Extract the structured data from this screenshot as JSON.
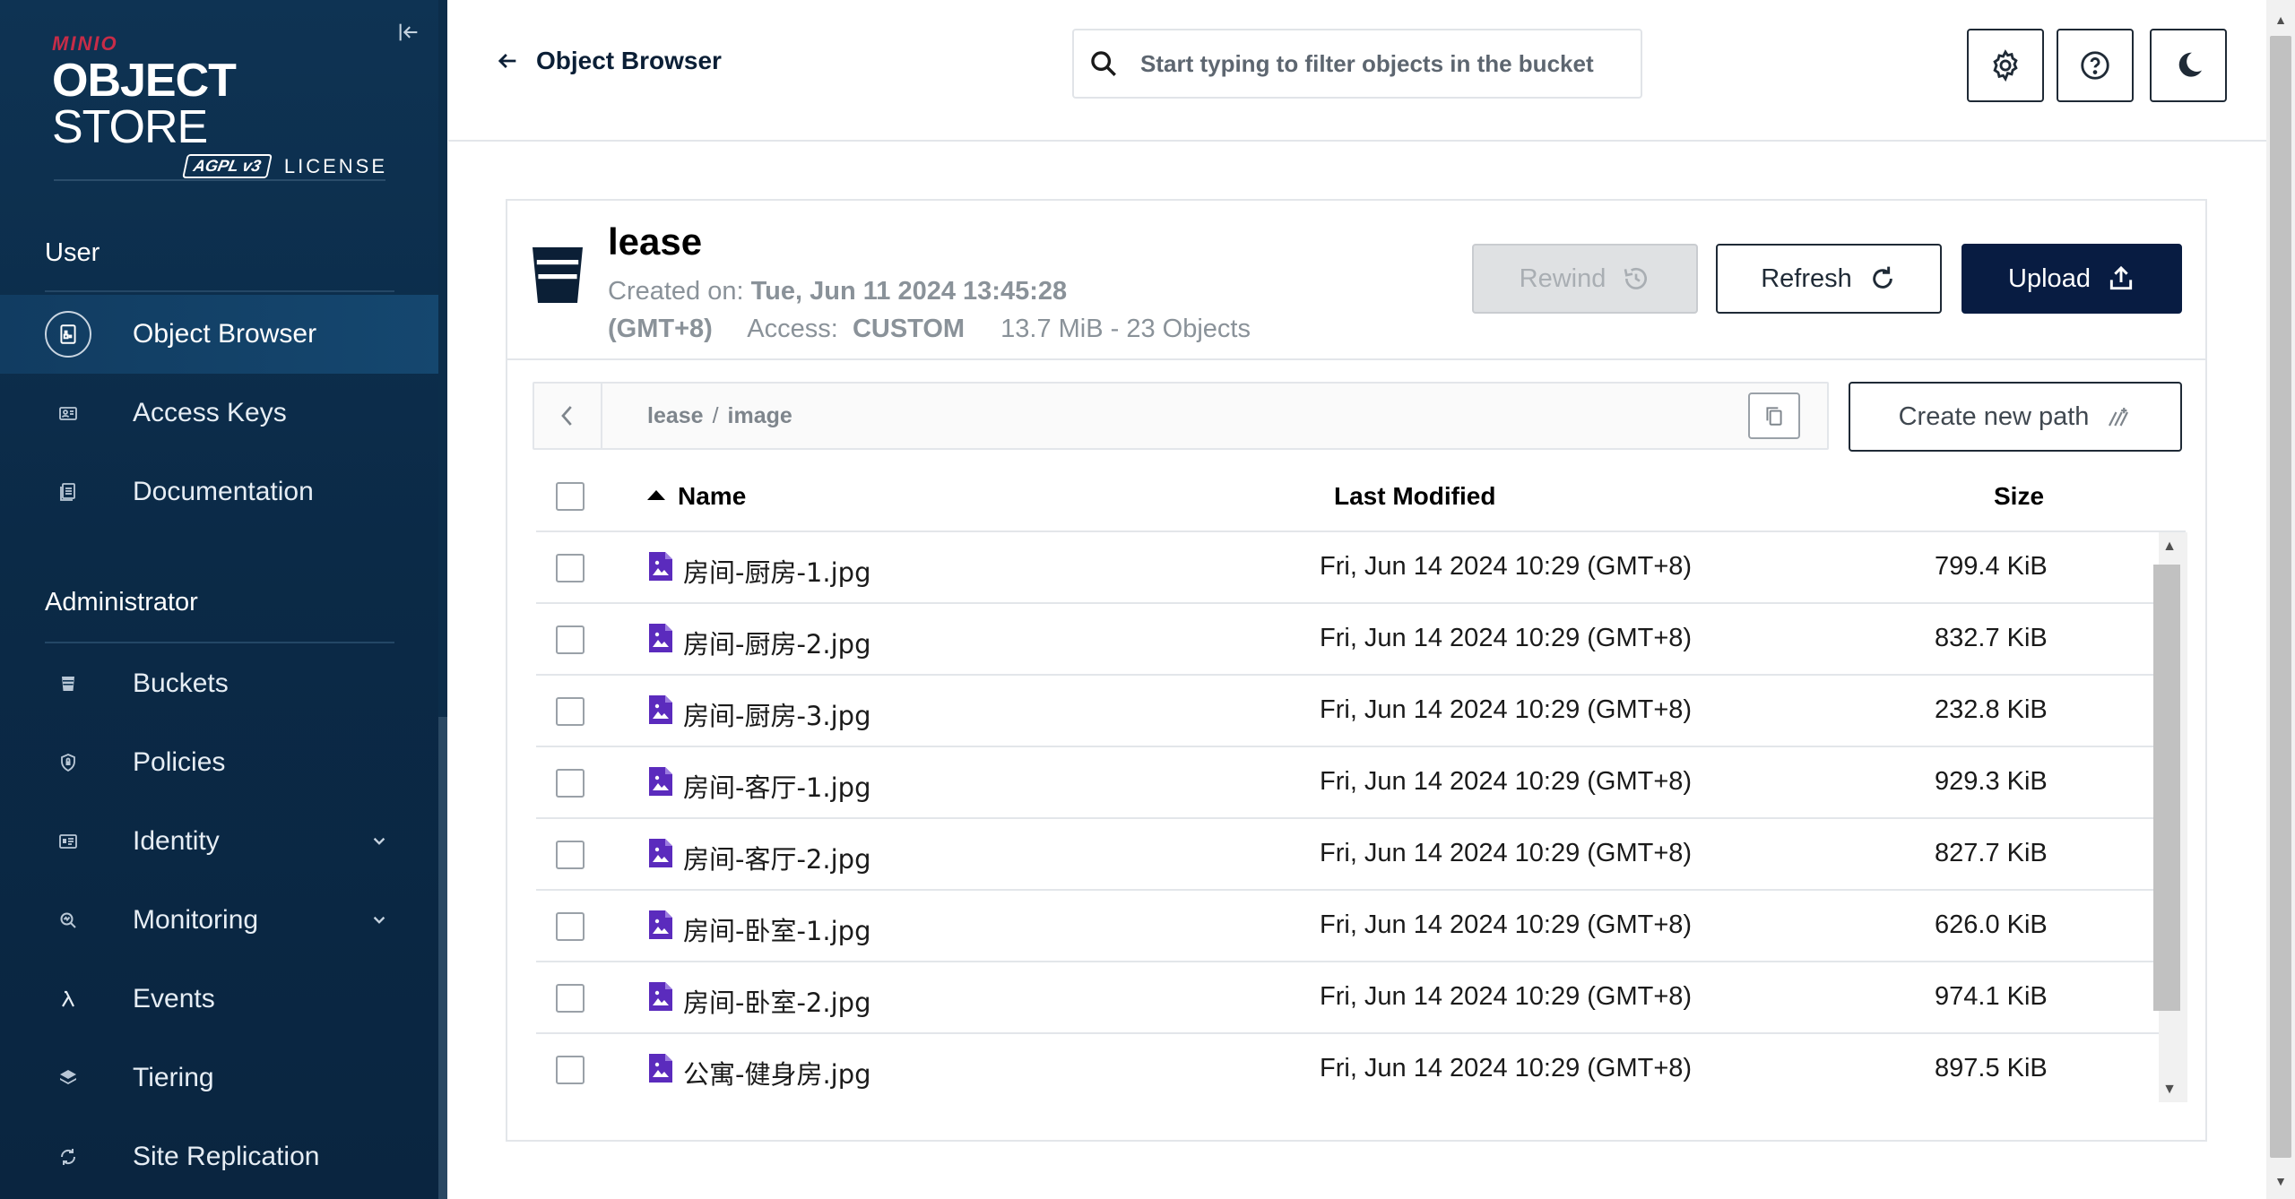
{
  "brand": {
    "minio": "MINIO",
    "title_bold": "OBJECT",
    "title_light": "STORE",
    "badge": "AGPL v3",
    "license": "LICENSE"
  },
  "sidebar": {
    "user_section": "User",
    "admin_section": "Administrator",
    "user_items": [
      {
        "label": "Object Browser",
        "icon": "object-browser-icon",
        "active": true
      },
      {
        "label": "Access Keys",
        "icon": "access-keys-icon"
      },
      {
        "label": "Documentation",
        "icon": "documentation-icon"
      }
    ],
    "admin_items": [
      {
        "label": "Buckets",
        "icon": "buckets-icon"
      },
      {
        "label": "Policies",
        "icon": "policies-icon"
      },
      {
        "label": "Identity",
        "icon": "identity-icon",
        "expandable": true
      },
      {
        "label": "Monitoring",
        "icon": "monitoring-icon",
        "expandable": true
      },
      {
        "label": "Events",
        "icon": "lambda-icon"
      },
      {
        "label": "Tiering",
        "icon": "tiering-icon"
      },
      {
        "label": "Site Replication",
        "icon": "replication-icon"
      }
    ]
  },
  "header": {
    "back_label": "Object Browser",
    "search_placeholder": "Start typing to filter objects in the bucket",
    "search_value": ""
  },
  "bucket": {
    "name": "lease",
    "created_label": "Created on:",
    "created_value": "Tue, Jun 11 2024 13:45:28",
    "timezone": "(GMT+8)",
    "access_label": "Access:",
    "access_value": "CUSTOM",
    "usage": "13.7 MiB - 23 Objects"
  },
  "actions": {
    "rewind": "Rewind",
    "refresh": "Refresh",
    "upload": "Upload",
    "create_path": "Create new path"
  },
  "breadcrumb": {
    "bucket": "lease",
    "separator": "/",
    "folder": "image"
  },
  "table": {
    "columns": {
      "name": "Name",
      "modified": "Last Modified",
      "size": "Size"
    },
    "rows": [
      {
        "name": "房间-厨房-1.jpg",
        "modified": "Fri, Jun 14 2024 10:29 (GMT+8)",
        "size": "799.4 KiB"
      },
      {
        "name": "房间-厨房-2.jpg",
        "modified": "Fri, Jun 14 2024 10:29 (GMT+8)",
        "size": "832.7 KiB"
      },
      {
        "name": "房间-厨房-3.jpg",
        "modified": "Fri, Jun 14 2024 10:29 (GMT+8)",
        "size": "232.8 KiB"
      },
      {
        "name": "房间-客厅-1.jpg",
        "modified": "Fri, Jun 14 2024 10:29 (GMT+8)",
        "size": "929.3 KiB"
      },
      {
        "name": "房间-客厅-2.jpg",
        "modified": "Fri, Jun 14 2024 10:29 (GMT+8)",
        "size": "827.7 KiB"
      },
      {
        "name": "房间-卧室-1.jpg",
        "modified": "Fri, Jun 14 2024 10:29 (GMT+8)",
        "size": "626.0 KiB"
      },
      {
        "name": "房间-卧室-2.jpg",
        "modified": "Fri, Jun 14 2024 10:29 (GMT+8)",
        "size": "974.1 KiB"
      },
      {
        "name": "公寓-健身房.jpg",
        "modified": "Fri, Jun 14 2024 10:29 (GMT+8)",
        "size": "897.5 KiB"
      }
    ]
  },
  "colors": {
    "sidebar_bg": "#0e3353",
    "accent_dark": "#081c42",
    "file_icon": "#5b2bbd",
    "brand_red": "#c72c48"
  }
}
